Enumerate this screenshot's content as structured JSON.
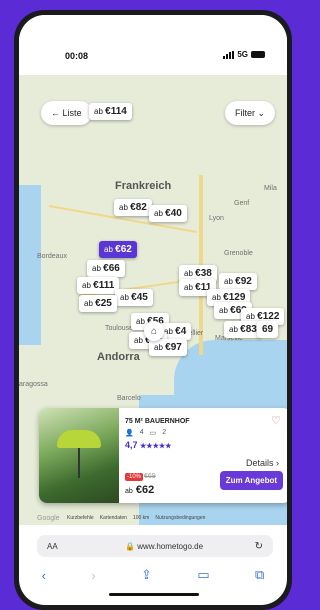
{
  "status": {
    "time": "00:08",
    "network": "5G"
  },
  "header": {
    "list_button": "Liste",
    "filter_button": "Filter"
  },
  "map": {
    "regions": {
      "country_france": "Frankreich",
      "country_andorra": "Andorra",
      "city_lyon": "Lyon",
      "city_genf": "Genf",
      "city_grenoble": "Grenoble",
      "city_bordeaux": "Bordeaux",
      "city_toulouse": "Toulouse",
      "city_montpellier": "Montpellier",
      "city_marseille": "Marseille",
      "city_barcelona": "Barcelo",
      "city_saragossa": "aragossa",
      "city_milano": "Mila"
    },
    "prices": [
      {
        "prefix": "ab",
        "value": "€114"
      },
      {
        "prefix": "ab",
        "value": "€82"
      },
      {
        "prefix": "ab",
        "value": "€40"
      },
      {
        "prefix": "ab",
        "value": "€62",
        "active": true
      },
      {
        "prefix": "ab",
        "value": "€66"
      },
      {
        "prefix": "ab",
        "value": "€111"
      },
      {
        "prefix": "ab",
        "value": "€45"
      },
      {
        "prefix": "ab",
        "value": "€25"
      },
      {
        "prefix": "ab",
        "value": "€38"
      },
      {
        "prefix": "ab",
        "value": "€11"
      },
      {
        "prefix": "ab",
        "value": "€92"
      },
      {
        "prefix": "ab",
        "value": "€129"
      },
      {
        "prefix": "ab",
        "value": "€69"
      },
      {
        "prefix": "ab",
        "value": "€56"
      },
      {
        "prefix": "ab",
        "value": "€4"
      },
      {
        "prefix": "ab",
        "value": "€40"
      },
      {
        "prefix": "ab",
        "value": "€97"
      },
      {
        "prefix": "ab",
        "value": "€122"
      },
      {
        "prefix": "ab",
        "value": "€83"
      },
      {
        "prefix": "",
        "value": "69"
      }
    ]
  },
  "card": {
    "title": "75 M² BAUERNHOF",
    "guests": "4",
    "rooms": "2",
    "rating": "4,7",
    "stars": "★★★★★",
    "details_label": "Details",
    "discount": "-10%",
    "old_price": "€69",
    "price_prefix": "ab",
    "price": "€62",
    "offer_button": "Zum Angebot"
  },
  "attribution": {
    "google": "Google",
    "shortcuts": "Kurzbefehle",
    "mapdata": "Kartendaten",
    "scale": "100 km",
    "terms": "Nutzungsbedingungen"
  },
  "browser": {
    "aa": "AA",
    "url": "www.hometogo.de"
  }
}
